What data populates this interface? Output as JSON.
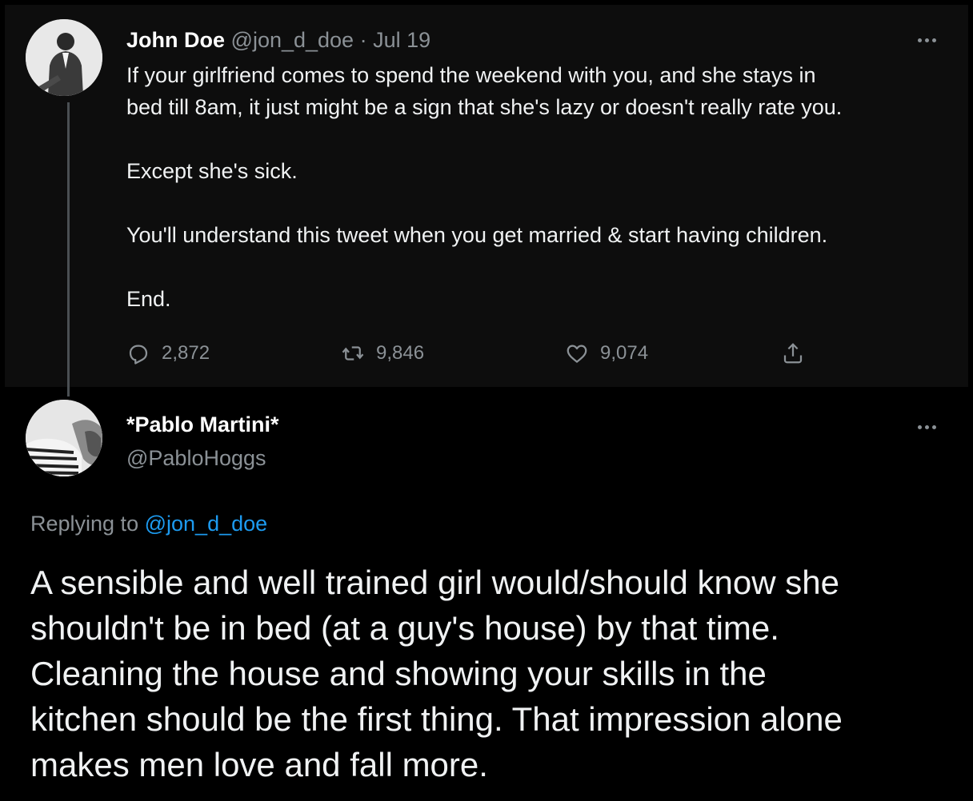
{
  "parent_tweet": {
    "author_name": "John Doe",
    "author_handle": "@jon_d_doe",
    "separator": "·",
    "date": "Jul 19",
    "body_lines": [
      "If your girlfriend comes to spend the weekend with you, and she stays in",
      "bed till 8am, it just might be a sign that she's lazy or doesn't really rate you.",
      "Except she's sick.",
      "You'll understand this tweet when you get married & start having children.",
      "End."
    ],
    "stats": {
      "replies": "2,872",
      "retweets": "9,846",
      "likes": "9,074"
    },
    "icons": {
      "avatar": "avatar-john",
      "reply": "reply-icon",
      "retweet": "retweet-icon",
      "like": "heart-icon",
      "share": "share-icon",
      "more": "more-icon"
    }
  },
  "reply_tweet": {
    "author_name": "*Pablo Martini*",
    "author_handle": "@PabloHoggs",
    "replying_prefix": "Replying to",
    "replying_to": "@jon_d_doe",
    "body_lines": [
      "A sensible and well trained girl would/should know she",
      "shouldn't be in bed (at a guy's house) by that time.",
      "Cleaning the house and showing your skills in the",
      "kitchen should be the first thing. That impression alone",
      "makes men love and fall more."
    ]
  },
  "colors": {
    "background": "#000000",
    "parent_background": "#0d0d0d",
    "primary_text": "#e7e9ea",
    "secondary_text": "#8b9196",
    "link": "#1d9bf0"
  }
}
